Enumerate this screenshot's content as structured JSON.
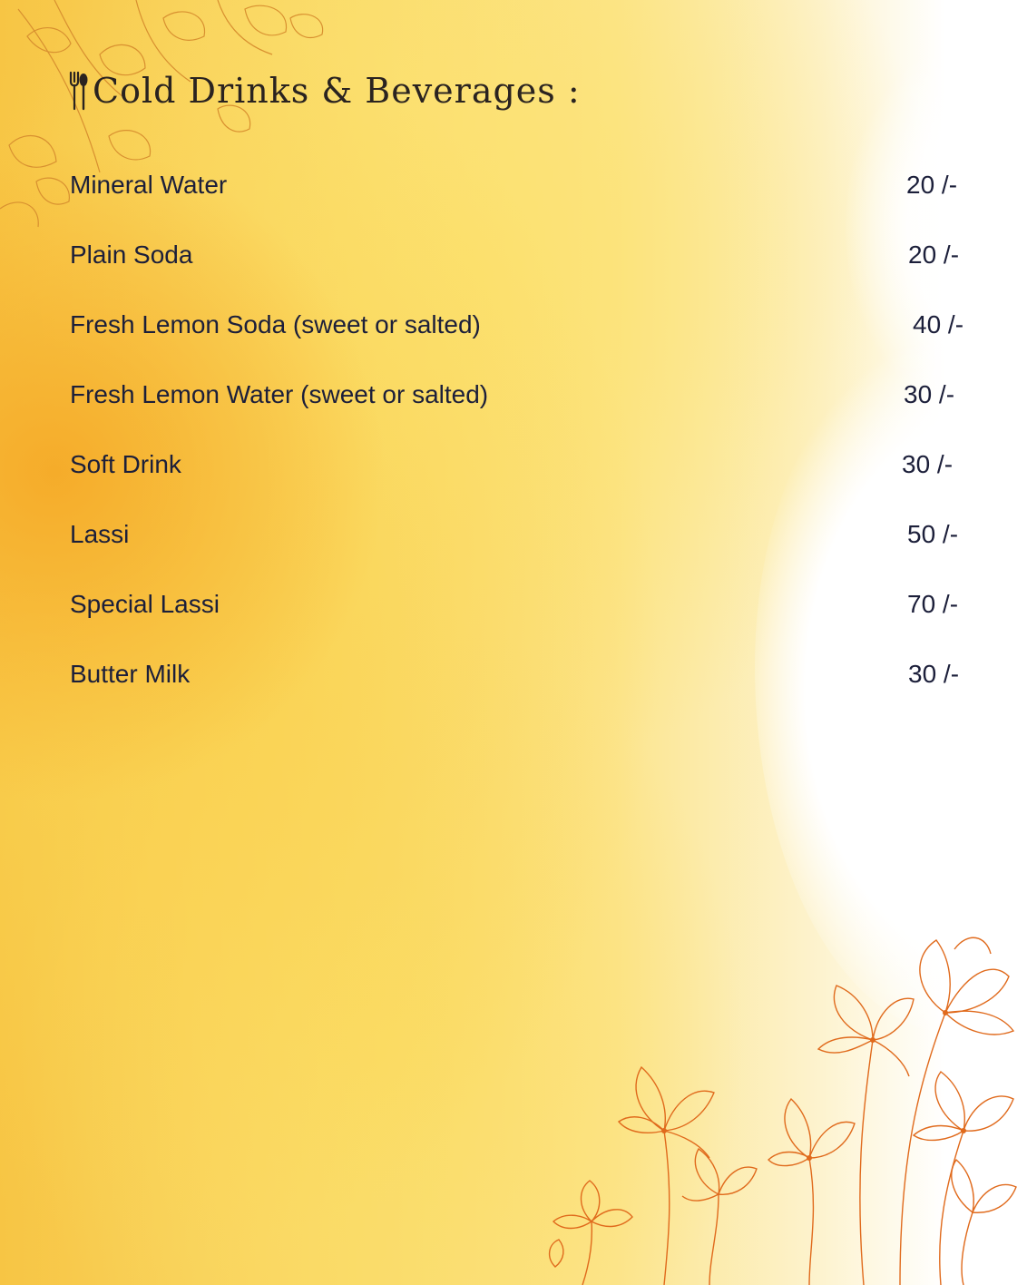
{
  "menu": {
    "title": "Cold Drinks & Beverages :",
    "title_icon": "fork-spoon-icon",
    "items": [
      {
        "name": "Mineral Water",
        "price": "20 /-"
      },
      {
        "name": "Plain Soda",
        "price": "20 /-"
      },
      {
        "name": "Fresh Lemon Soda (sweet or salted)",
        "price": "40 /-"
      },
      {
        "name": "Fresh Lemon Water (sweet or salted)",
        "price": "30 /-"
      },
      {
        "name": "Soft Drink",
        "price": "30 /-"
      },
      {
        "name": "Lassi",
        "price": "50 /-"
      },
      {
        "name": "Special Lassi",
        "price": "70 /-"
      },
      {
        "name": "Butter Milk",
        "price": "30 /-"
      }
    ]
  },
  "colors": {
    "text": "#1c1f3a",
    "floral_stroke": "#e06a1c",
    "background_accent": "#f7c544"
  }
}
